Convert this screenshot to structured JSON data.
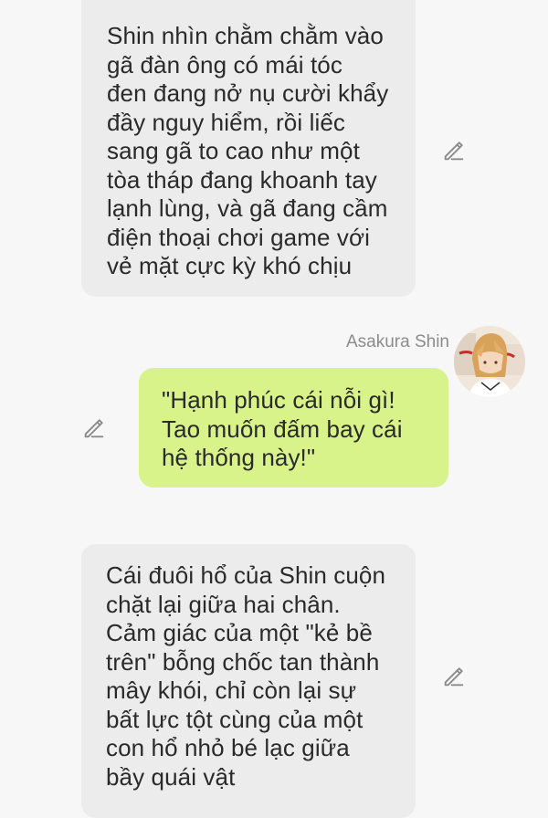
{
  "messages": [
    {
      "type": "narration",
      "text": "Shin nhìn chằm chằm vào\ngã đàn ông có mái tóc\nđen đang nở nụ cười khẩy\nđầy nguy hiểm, rồi liếc\nsang gã to cao như một\ntòa tháp đang khoanh tay\nlạnh lùng, và gã đang cầm\nđiện thoại chơi game với\nvẻ mặt cực kỳ khó chịu",
      "icon": "pencil-edit-icon"
    },
    {
      "type": "character",
      "sender": "Asakura Shin",
      "text": "\"Hạnh phúc cái nỗi gì!\nTao muốn đấm bay cái\nhệ thống này!\"",
      "icon": "pencil-edit-icon",
      "bubble_color": "#d7f38a"
    },
    {
      "type": "narration",
      "text": "Cái đuôi hổ của Shin cuộn\nchặt lại giữa hai chân.\nCảm giác của một \"kẻ bề\ntrên\" bỗng chốc tan thành\nmây khói, chỉ còn lại sự\nbất lực tột cùng của một\ncon hổ nhỏ bé lạc giữa\nbầy quái vật",
      "icon": "pencil-edit-icon"
    }
  ],
  "colors": {
    "background": "#f7f7f7",
    "narration_bubble": "#ececec",
    "user_bubble": "#d7f38a",
    "text": "#2a2a2a",
    "sender_name": "#8c8c8c"
  }
}
